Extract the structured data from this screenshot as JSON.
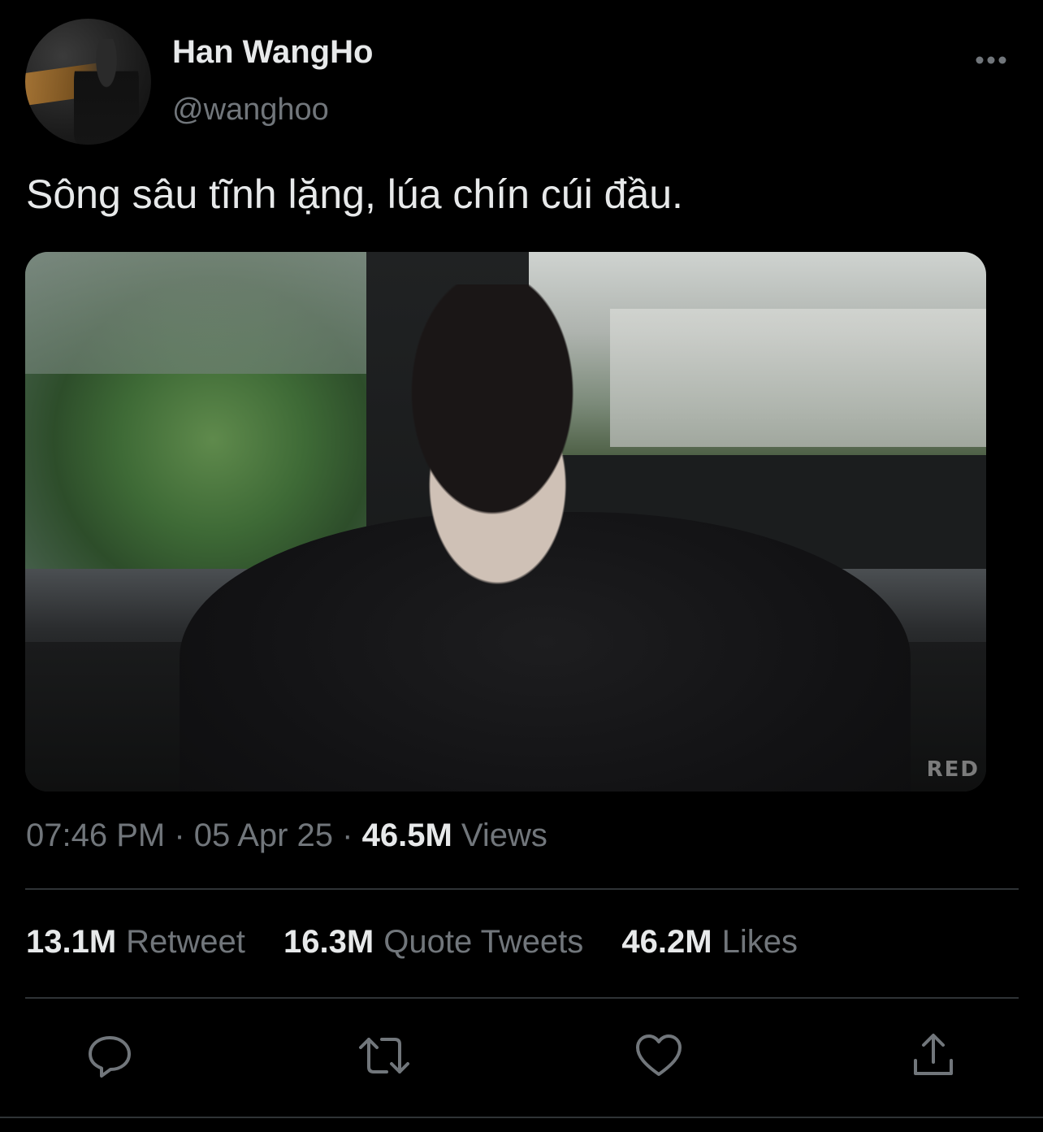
{
  "author": {
    "display_name": "Han WangHo",
    "handle": "@wanghoo"
  },
  "tweet": {
    "text": "Sông sâu tĩnh lặng, lúa chín cúi đầu.",
    "media_watermark": "RED"
  },
  "meta": {
    "time": "07:46 PM",
    "separator": "·",
    "date": "05 Apr 25",
    "views_count": "46.5M",
    "views_label": "Views"
  },
  "stats": [
    {
      "count": "13.1M",
      "label": "Retweet"
    },
    {
      "count": "16.3M",
      "label": "Quote Tweets"
    },
    {
      "count": "46.2M",
      "label": "Likes"
    }
  ],
  "icons": {
    "more": "more-icon",
    "reply": "reply-icon",
    "retweet": "retweet-icon",
    "like": "heart-icon",
    "share": "share-icon"
  },
  "colors": {
    "background": "#000000",
    "primary_text": "#e7e9ea",
    "secondary_text": "#71767b",
    "divider": "#2f3336"
  }
}
